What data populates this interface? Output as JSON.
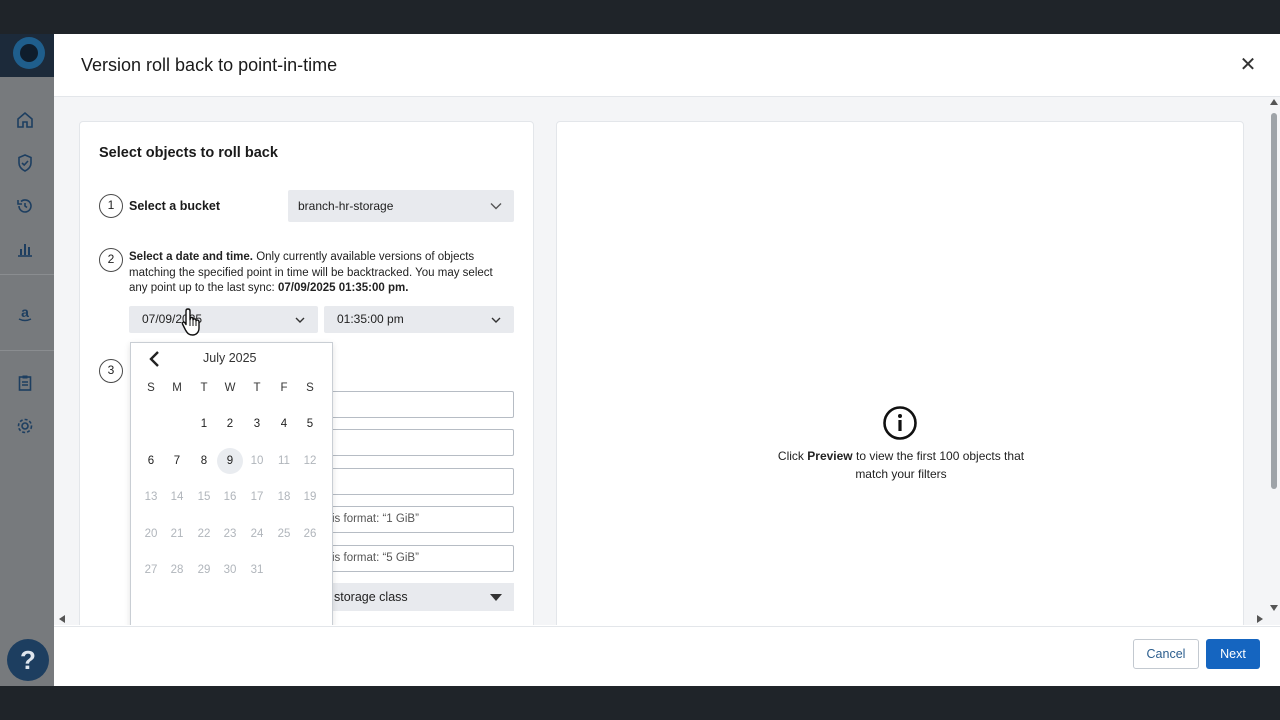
{
  "modal": {
    "title": "Version roll back to point-in-time",
    "close_icon": "close-icon"
  },
  "sidebar": {
    "icons": [
      "home-icon",
      "shield-check-icon",
      "history-icon",
      "bar-chart-icon",
      "amazon-icon",
      "clipboard-icon",
      "gear-icon"
    ],
    "help_label": "?"
  },
  "left_panel": {
    "title": "Select objects to roll back",
    "step1": {
      "number": "1",
      "label": "Select a bucket",
      "bucket_value": "branch-hr-storage"
    },
    "step2": {
      "number": "2",
      "label": "Select a date and time.",
      "description": "Only currently available versions of objects matching the specified point in time will be backtracked. You may select any point up to the last sync:",
      "last_sync": "07/09/2025 01:35:00 pm.",
      "date_value": "07/09/2025",
      "time_value": "01:35:00 pm"
    },
    "step3": {
      "number": "3"
    },
    "fields": {
      "min_size_hint": "is format: “1 GiB”",
      "max_size_hint": "is format: “5 GiB”",
      "storage_class": "storage class"
    }
  },
  "calendar": {
    "month_label": "July 2025",
    "weekdays": [
      "S",
      "M",
      "T",
      "W",
      "T",
      "F",
      "S"
    ],
    "weeks": [
      [
        "",
        "",
        "1",
        "2",
        "3",
        "4",
        "5"
      ],
      [
        "6",
        "7",
        "8",
        "9",
        "10",
        "11",
        "12"
      ],
      [
        "13",
        "14",
        "15",
        "16",
        "17",
        "18",
        "19"
      ],
      [
        "20",
        "21",
        "22",
        "23",
        "24",
        "25",
        "26"
      ],
      [
        "27",
        "28",
        "29",
        "30",
        "31",
        "",
        ""
      ]
    ],
    "selected_day": "9",
    "last_enabled_day": 9
  },
  "right_panel": {
    "empty_prefix": "Click",
    "empty_bold": "Preview",
    "empty_suffix": "to view the first 100 objects that match your filters"
  },
  "footer": {
    "cancel_label": "Cancel",
    "next_label": "Next"
  },
  "colors": {
    "primary": "#1565c0",
    "sidebar": "#777a7d",
    "frame": "#1f2429"
  }
}
